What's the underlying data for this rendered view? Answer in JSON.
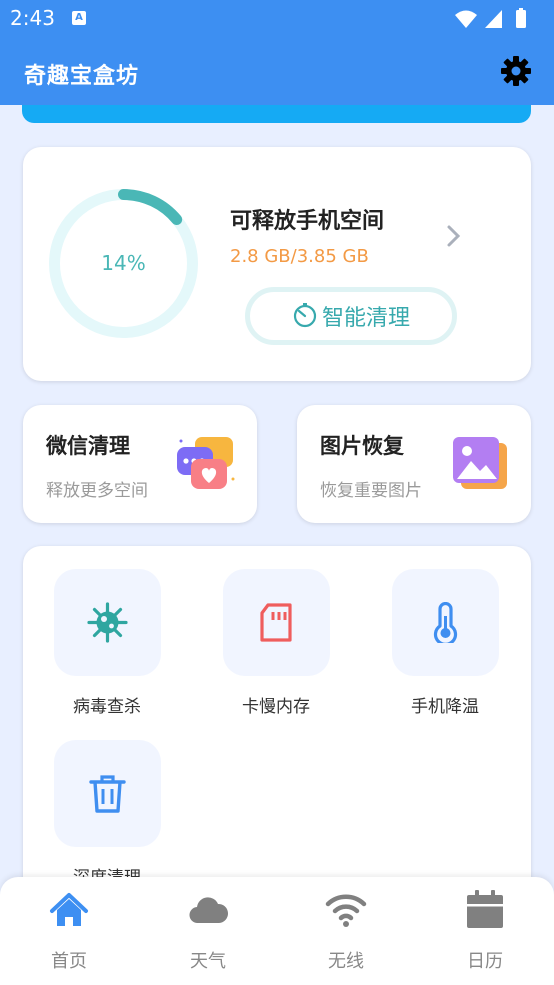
{
  "status_bar": {
    "time": "2:43",
    "notification_icon": "A"
  },
  "app": {
    "title": "奇趣宝盒坊"
  },
  "storage": {
    "percent_label": "14%",
    "percent": 14,
    "title": "可释放手机空间",
    "value": "2.8 GB/3.85 GB",
    "clean_button": "智能清理"
  },
  "cards": [
    {
      "title": "微信清理",
      "subtitle": "释放更多空间",
      "icon": "wechat-chat-icon"
    },
    {
      "title": "图片恢复",
      "subtitle": "恢复重要图片",
      "icon": "photo-icon"
    }
  ],
  "tools": [
    {
      "label": "病毒查杀",
      "icon": "virus-icon"
    },
    {
      "label": "卡慢内存",
      "icon": "sd-card-icon"
    },
    {
      "label": "手机降温",
      "icon": "thermometer-icon"
    },
    {
      "label": "深度清理",
      "icon": "trash-icon"
    }
  ],
  "nav": [
    {
      "label": "首页",
      "icon": "home-icon",
      "active": true
    },
    {
      "label": "天气",
      "icon": "cloud-icon",
      "active": false
    },
    {
      "label": "无线",
      "icon": "wifi-icon",
      "active": false
    },
    {
      "label": "日历",
      "icon": "calendar-icon",
      "active": false
    }
  ],
  "colors": {
    "primary": "#3d8ff2",
    "accent_teal": "#4ab7b6",
    "warning_orange": "#f39a45",
    "background": "#e8efff"
  }
}
